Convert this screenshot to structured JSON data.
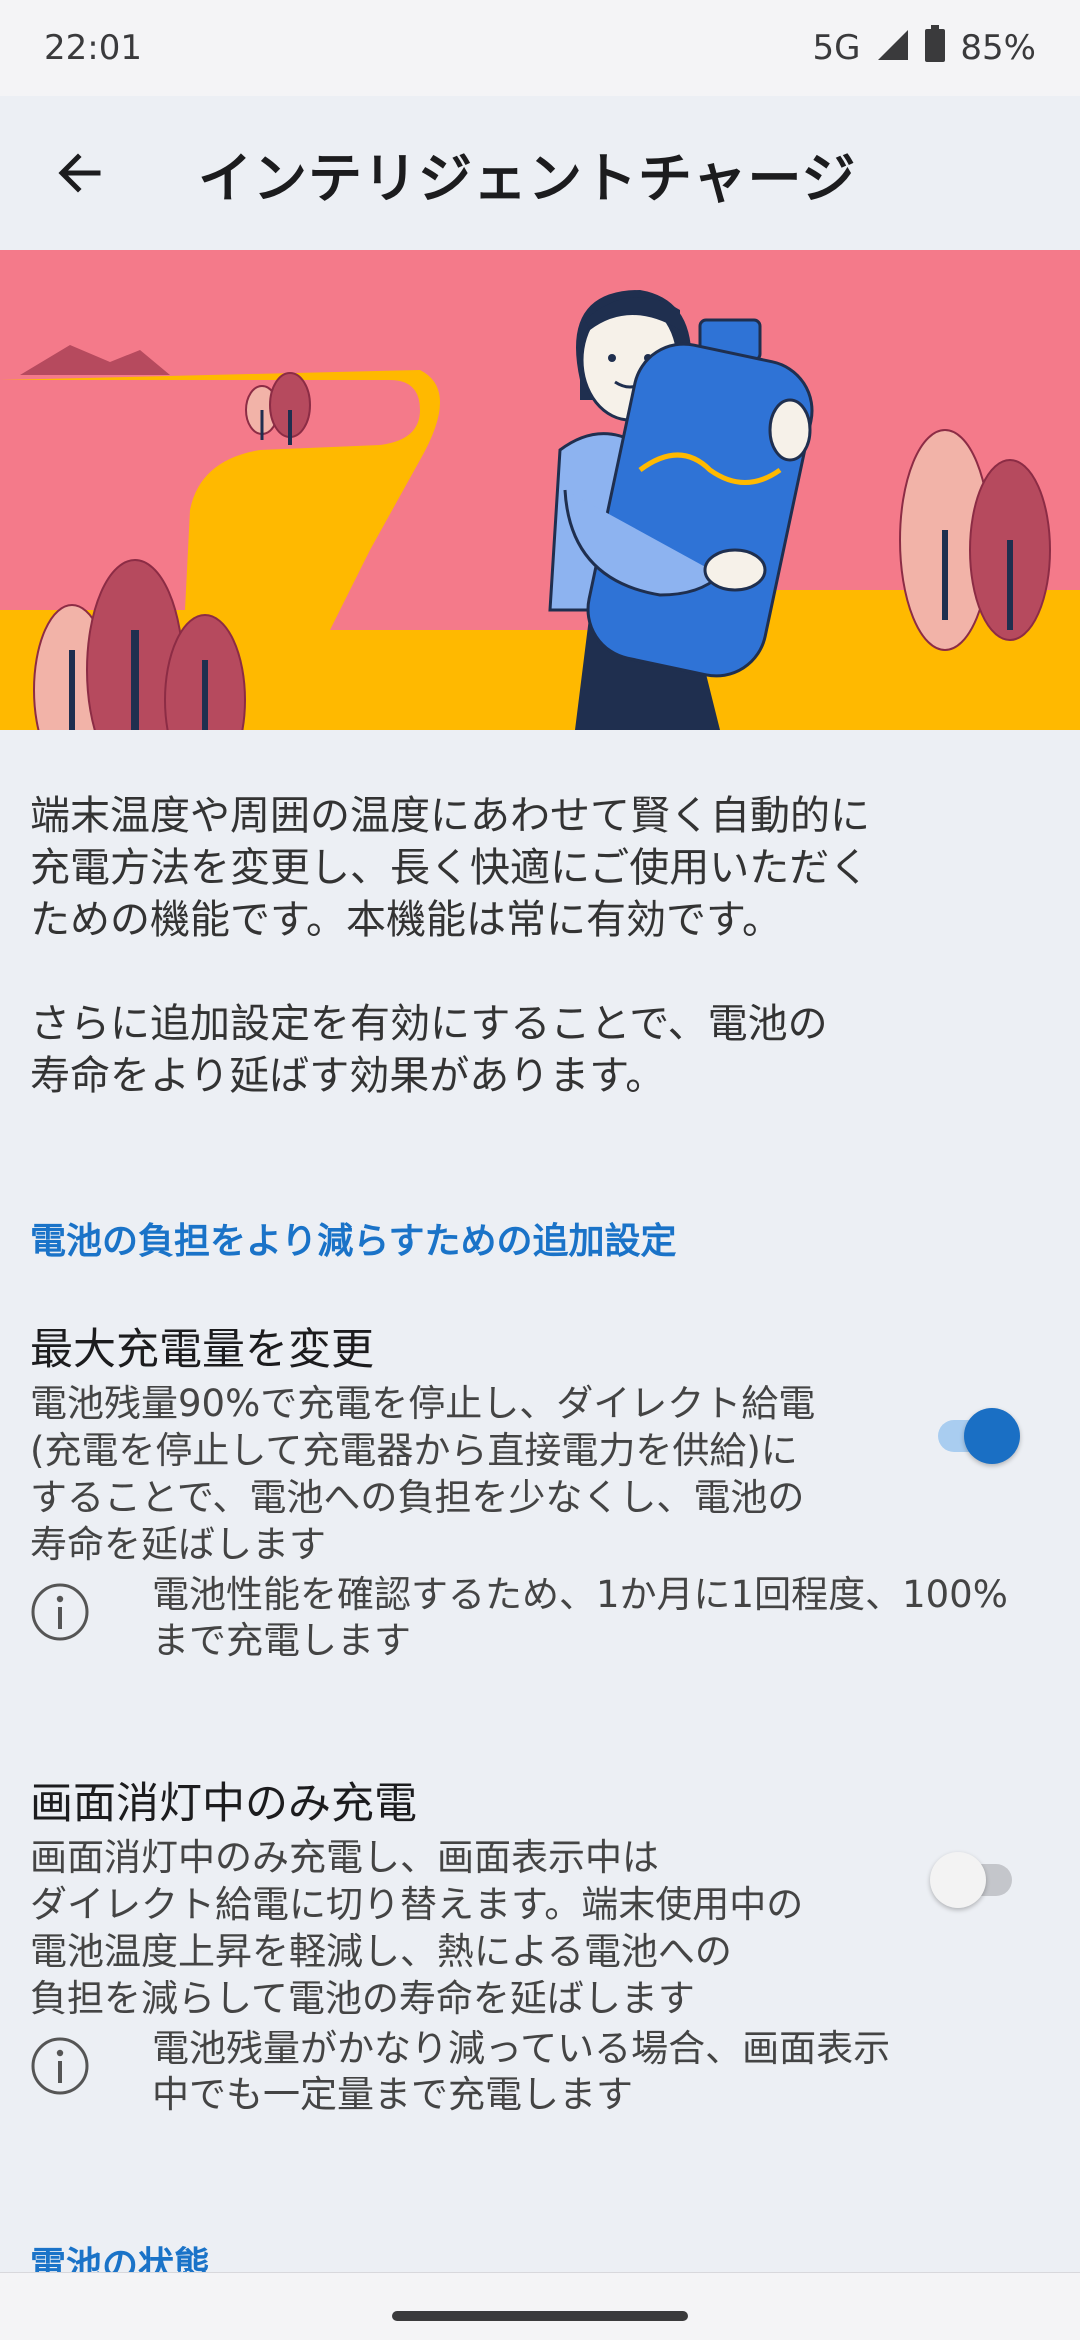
{
  "status_bar": {
    "time": "22:01",
    "network": "5G",
    "battery": "85%",
    "signal_icon": "signal-icon",
    "battery_icon": "battery-icon"
  },
  "app_bar": {
    "back_icon": "arrow-left-icon",
    "title": "インテリジェントチャージ"
  },
  "hero": {
    "illustration": "woman-hugging-battery-illustration",
    "colors": {
      "sky": "#f47a8a",
      "road": "#ffb900",
      "battery": "#2f73d6"
    }
  },
  "intro": {
    "paragraph1": "端末温度や周囲の温度にあわせて賢く自動的に\n充電方法を変更し、長く快適にご使用いただく\nための機能です。本機能は常に有効です。",
    "paragraph2": "さらに追加設定を有効にすることで、電池の\n寿命をより延ばす効果があります。"
  },
  "section_additional": {
    "header": "電池の負担をより減らすための追加設定"
  },
  "settings": [
    {
      "title": "最大充電量を変更",
      "description": "電池残量90%で充電を停止し、ダイレクト給電\n(充電を停止して充電器から直接電力を供給)に\nすることで、電池への負担を少なくし、電池の\n寿命を延ばします",
      "enabled": true,
      "info": "電池性能を確認するため、1か月に1回程度、100%\nまで充電します"
    },
    {
      "title": "画面消灯中のみ充電",
      "description": "画面消灯中のみ充電し、画面表示中は\nダイレクト給電に切り替えます。端末使用中の\n電池温度上昇を軽減し、熱による電池への\n負担を減らして電池の寿命を延ばします",
      "enabled": false,
      "info": "電池残量がかなり減っている場合、画面表示\n中でも一定量まで充電します"
    }
  ],
  "section_battery_status": {
    "header": "電池の状態"
  },
  "colors": {
    "accent": "#1a73c8",
    "background": "#eceff4"
  }
}
